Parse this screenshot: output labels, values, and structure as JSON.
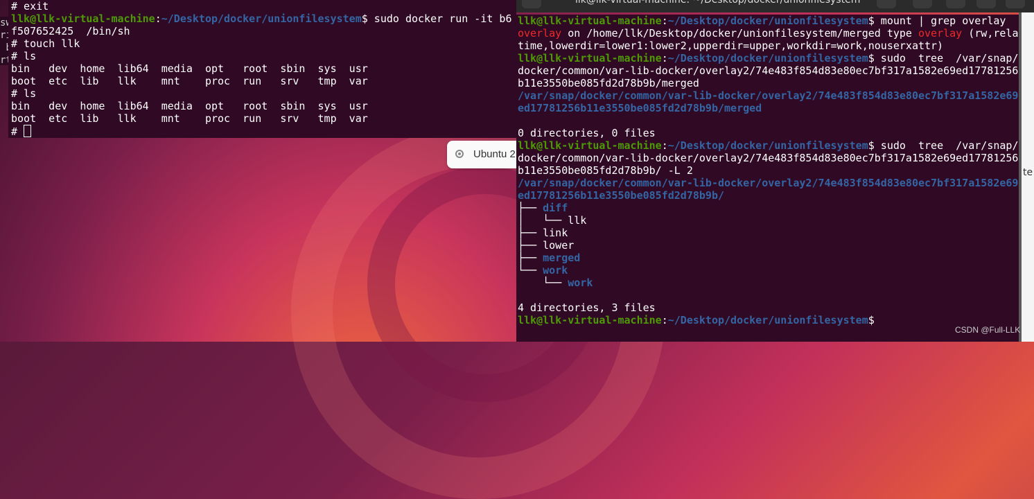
{
  "left_terminal": {
    "lines": [
      "# exit",
      "",
      "f507652425  /bin/sh",
      "# touch llk",
      "# ls",
      "bin   dev  home  lib64  media  opt   root  sbin  sys  usr",
      "boot  etc  lib   llk    mnt    proc  run   srv   tmp  var",
      "# ls",
      "bin   dev  home  lib64  media  opt   root  sbin  sys  usr",
      "boot  etc  lib   llk    mnt    proc  run   srv   tmp  var",
      "# "
    ],
    "prompt_user": "llk@llk-virtual-machine",
    "prompt_path": "~/Desktop/docker/unionfilesystem",
    "command_docker": " sudo docker run -it b6"
  },
  "behind_window": {
    "text": [
      "sw",
      "ri",
      " b",
      "rt"
    ]
  },
  "notification": {
    "label": "Ubuntu 2"
  },
  "right_terminal": {
    "title": "llk@llk-virtual-machine: ~/Desktop/docker/unionfilesystem",
    "prompt_user": "llk@llk-virtual-machine",
    "prompt_path": "~/Desktop/docker/unionfilesystem",
    "cmd_mount": " mount | grep overlay",
    "mount_out_1_word": "overlay",
    "mount_out_1_mid": " on /home/llk/Desktop/docker/unionfilesystem/merged type ",
    "mount_out_1_word2": "overlay",
    "mount_out_1_end": " (rw,rela",
    "mount_out_2": "time,lowerdir=lower1:lower2,upperdir=upper,workdir=work,nouserxattr)",
    "cmd_tree1": " sudo  tree  /var/snap/",
    "tree1_cont_1": "docker/common/var-lib-docker/overlay2/74e483f854d83e80ec7bf317a1582e69ed17781256",
    "tree1_cont_2": "b11e3550be085fd2d78b9b/merged",
    "tree1_out_1": "/var/snap/docker/common/var-lib-docker/overlay2/74e483f854d83e80ec7bf317a1582e69",
    "tree1_out_2": "ed17781256b11e3550be085fd2d78b9b/merged",
    "tree1_summary": "0 directories, 0 files",
    "cmd_tree2": " sudo  tree  /var/snap/",
    "tree2_cont_1": "docker/common/var-lib-docker/overlay2/74e483f854d83e80ec7bf317a1582e69ed17781256",
    "tree2_cont_2": "b11e3550be085fd2d78b9b/ -L 2",
    "tree2_out_1": "/var/snap/docker/common/var-lib-docker/overlay2/74e483f854d83e80ec7bf317a1582e69",
    "tree2_out_2": "ed17781256b11e3550be085fd2d78b9b/",
    "tree": [
      {
        "prefix": "├── ",
        "name": "diff",
        "dir": true
      },
      {
        "prefix": "│   └── ",
        "name": "llk",
        "dir": false
      },
      {
        "prefix": "├── ",
        "name": "link",
        "dir": false
      },
      {
        "prefix": "├── ",
        "name": "lower",
        "dir": false
      },
      {
        "prefix": "├── ",
        "name": "merged",
        "dir": true
      },
      {
        "prefix": "└── ",
        "name": "work",
        "dir": true
      },
      {
        "prefix": "    └── ",
        "name": "work",
        "dir": true
      }
    ],
    "tree2_summary": "4 directories, 3 files"
  },
  "side_panel": {
    "fragment": "te"
  },
  "watermark": "CSDN @Full-LLK",
  "colors": {
    "terminal_bg": "#300a24",
    "prompt_user": "#4e9a06",
    "prompt_path": "#3465a4",
    "highlight": "#ef2929"
  }
}
